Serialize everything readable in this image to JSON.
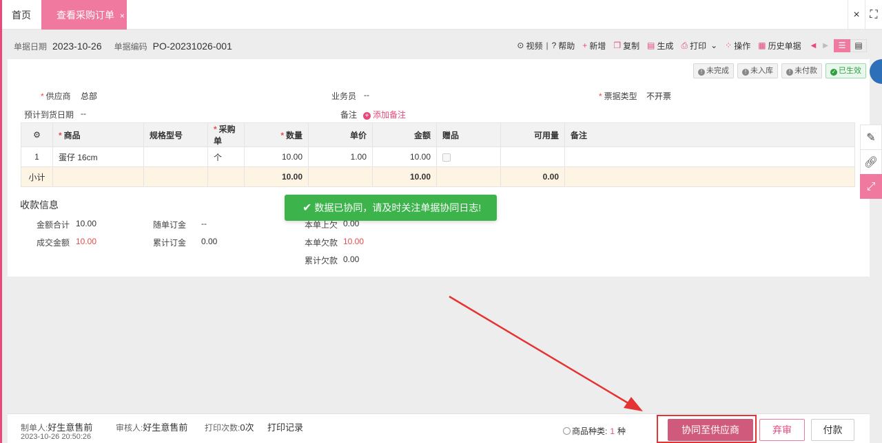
{
  "tabs": {
    "home": "首页",
    "active": "查看采购订单",
    "active_close": "×",
    "close_all": "×",
    "fullscreen": "⛶"
  },
  "header": {
    "date_label": "单据日期",
    "date_value": "2023-10-26",
    "code_label": "单据编码",
    "code_value": "PO-20231026-001"
  },
  "toolbar": {
    "video": "视频",
    "help": "帮助",
    "add": "新增",
    "copy": "复制",
    "generate": "生成",
    "print": "打印",
    "operate": "操作",
    "history": "历史单据"
  },
  "status": [
    "未完成",
    "未入库",
    "未付款",
    "已生效"
  ],
  "form": {
    "supplier_label": "供应商",
    "supplier_value": "总部",
    "salesman_label": "业务员",
    "salesman_value": "--",
    "invoice_label": "票据类型",
    "invoice_value": "不开票",
    "eta_label": "预计到货日期",
    "eta_value": "--",
    "note_label": "备注",
    "add_note": "添加备注"
  },
  "table": {
    "headers": [
      "",
      "商品",
      "规格型号",
      "采购单",
      "数量",
      "单价",
      "金额",
      "赠品",
      "可用量",
      "备注"
    ],
    "rows": [
      [
        "1",
        "蛋仔 16cm",
        "",
        "个",
        "10.00",
        "1.00",
        "10.00",
        "",
        "",
        ""
      ]
    ],
    "subtotal": {
      "label": "小计",
      "qty": "10.00",
      "amount": "10.00",
      "available": "0.00"
    }
  },
  "payment": {
    "title": "收款信息",
    "total_label": "金额合计",
    "total_value": "10.00",
    "deal_label": "成交金额",
    "deal_value": "10.00",
    "with_order_label": "随单订金",
    "with_order_value": "--",
    "cum_deposit_label": "累计订金",
    "cum_deposit_value": "0.00",
    "prev_debt_label": "本单上欠",
    "prev_debt_value": "0.00",
    "cur_debt_label": "本单欠款",
    "cur_debt_value": "10.00",
    "cum_debt_label": "累计欠款",
    "cum_debt_value": "0.00"
  },
  "toast": "数据已协同，请及时关注单据协同日志!",
  "footer": {
    "maker_label": "制单人:",
    "maker_value": "好生意售前",
    "maker_time": "2023-10-26 20:50:26",
    "auditor_label": "审核人:",
    "auditor_value": "好生意售前",
    "print_count_label": "打印次数:",
    "print_count_value": "0次",
    "print_record": "打印记录",
    "goods_kinds_label": "商品种类:",
    "goods_kinds_value": "1",
    "goods_kinds_unit": "种",
    "sync_button": "协同至供应商",
    "abandon_button": "弃审",
    "pay_button": "付款"
  },
  "colors": {
    "brand": "#f0799f",
    "sync_button": "#d05a7b",
    "toast": "#3cb44b",
    "annotation": "#e53333"
  }
}
